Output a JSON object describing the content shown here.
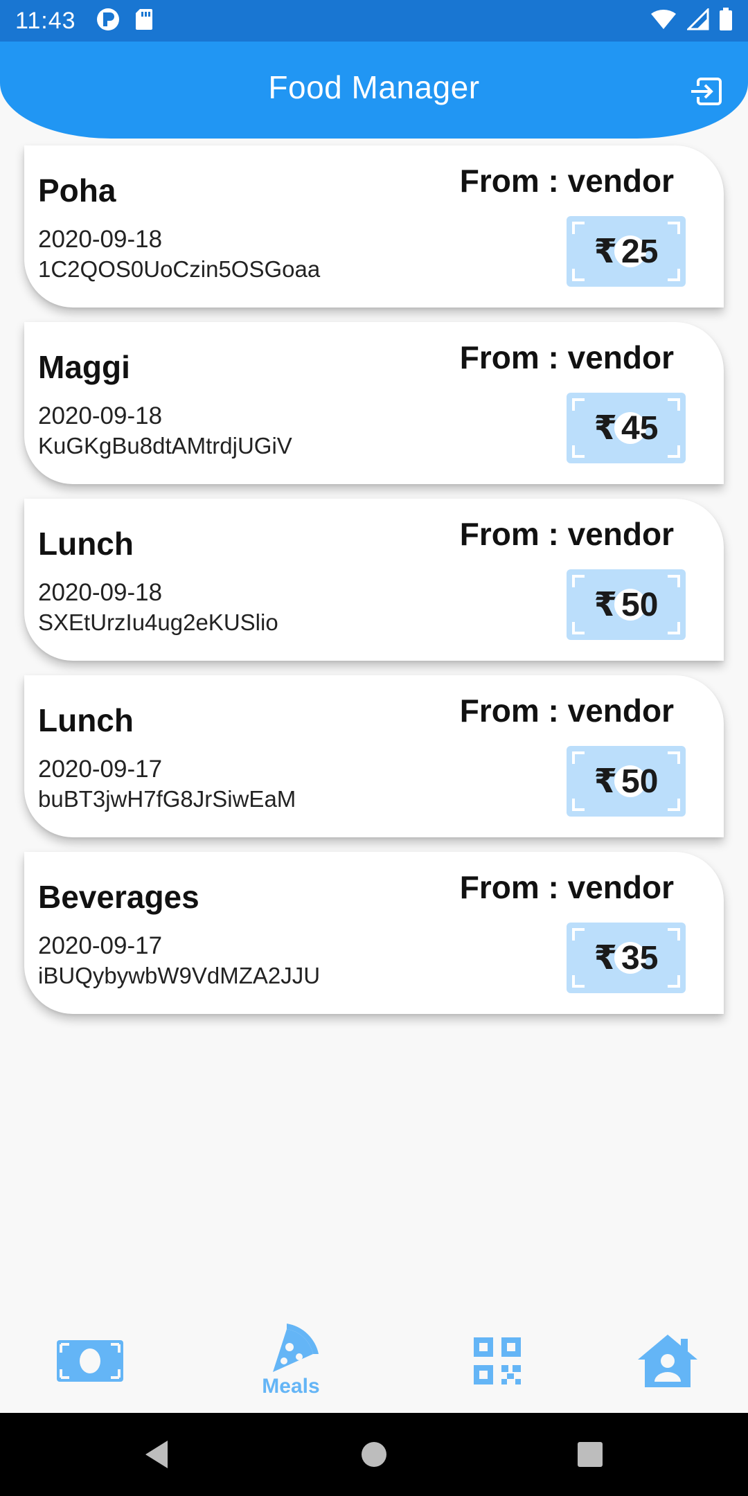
{
  "status_bar": {
    "time": "11:43"
  },
  "app_bar": {
    "title": "Food Manager"
  },
  "meals": [
    {
      "name": "Poha",
      "date": "2020-09-18",
      "id": "1C2QOS0UoCzin5OSGoaa",
      "from": "From : vendor",
      "currency": "₹",
      "price": "25"
    },
    {
      "name": "Maggi",
      "date": "2020-09-18",
      "id": "KuGKgBu8dtAMtrdjUGiV",
      "from": "From : vendor",
      "currency": "₹",
      "price": "45"
    },
    {
      "name": "Lunch",
      "date": "2020-09-18",
      "id": "SXEtUrzIu4ug2eKUSlio",
      "from": "From : vendor",
      "currency": "₹",
      "price": "50"
    },
    {
      "name": "Lunch",
      "date": "2020-09-17",
      "id": "buBT3jwH7fG8JrSiwEaM",
      "from": "From : vendor",
      "currency": "₹",
      "price": "50"
    },
    {
      "name": "Beverages",
      "date": "2020-09-17",
      "id": "iBUQybywbW9VdMZA2JJU",
      "from": "From : vendor",
      "currency": "₹",
      "price": "35"
    }
  ],
  "bottom_nav": {
    "items": [
      {
        "icon": "money-icon",
        "label": ""
      },
      {
        "icon": "pizza-icon",
        "label": "Meals",
        "active": true
      },
      {
        "icon": "qr-code-icon",
        "label": ""
      },
      {
        "icon": "home-person-icon",
        "label": ""
      }
    ]
  },
  "colors": {
    "primary": "#2196f3",
    "status_bar": "#1976d2",
    "nav_icon": "#64b5f6",
    "price_badge": "#bbdefb"
  }
}
